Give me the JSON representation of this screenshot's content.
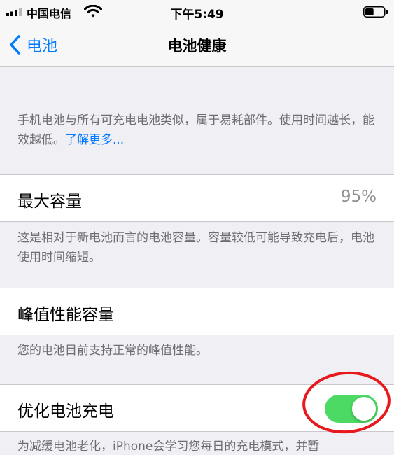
{
  "status_bar": {
    "carrier": "中国电信",
    "time": "下午5:49",
    "battery_level": 0.45
  },
  "nav": {
    "back_label": "电池",
    "title": "电池健康"
  },
  "intro": {
    "text": "手机电池与所有可充电电池类似，属于易耗部件。使用时间越长，能效越低。",
    "link": "了解更多..."
  },
  "max_capacity": {
    "label": "最大容量",
    "value": "95%",
    "footer": "这是相对于新电池而言的电池容量。容量较低可能导致充电后，电池使用时间缩短。"
  },
  "peak_performance": {
    "label": "峰值性能容量",
    "footer": "您的电池目前支持正常的峰值性能。"
  },
  "optimized_charging": {
    "label": "优化电池充电",
    "enabled": true,
    "footer": "为减缓电池老化，iPhone会学习您每日的充电模式，并暂"
  },
  "colors": {
    "accent": "#007aff",
    "toggle_on": "#4cd964",
    "annotation": "#e8191c"
  }
}
